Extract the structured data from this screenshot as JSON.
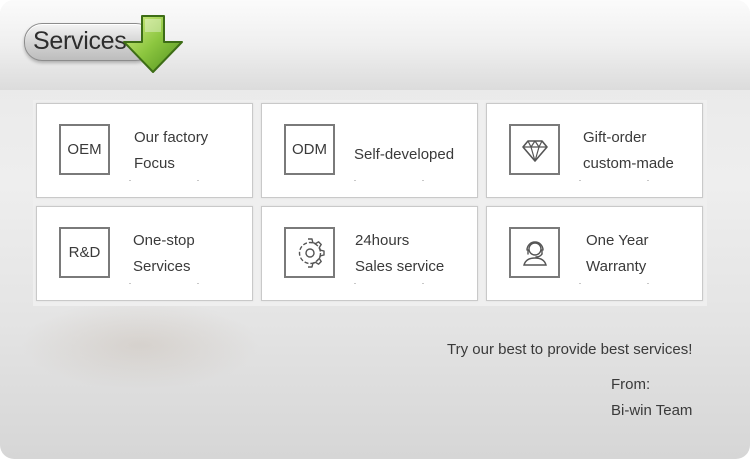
{
  "header": {
    "title": "Services",
    "icon": "down-arrow-icon",
    "accent_color": "#8cc63f"
  },
  "services": [
    {
      "badge": "OEM",
      "line1": "Our factory",
      "line2": "Focus"
    },
    {
      "badge": "ODM",
      "line1": "Self-developed",
      "line2": ""
    },
    {
      "badge": "",
      "icon": "diamond-icon",
      "line1": "Gift-order",
      "line2": "custom-made"
    },
    {
      "badge": "R&D",
      "line1": "One-stop",
      "line2": "Services"
    },
    {
      "badge": "",
      "icon": "gear-icon",
      "line1": "24hours",
      "line2": "Sales service"
    },
    {
      "badge": "",
      "icon": "support-agent-icon",
      "line1": "One Year",
      "line2": "Warranty"
    }
  ],
  "footer": {
    "tagline": "Try our best to provide best services!",
    "from_label": "From:",
    "team": "Bi-win Team"
  }
}
